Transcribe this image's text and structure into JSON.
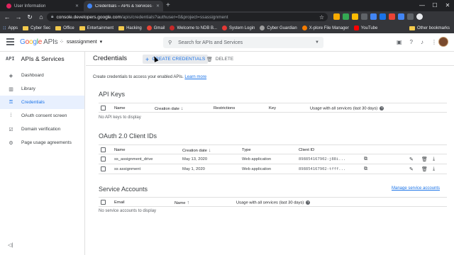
{
  "browser": {
    "tabs": [
      {
        "title": "User Information",
        "favicon_color": "#e0245e",
        "active": false
      },
      {
        "title": "Credentials – APIs & Services – s…",
        "favicon_color": "#4285f4",
        "active": true
      }
    ],
    "url_host": "console.developers.google.com",
    "url_path": "/apis/credentials?authuser=0&project=ssassignment",
    "bookmarks": [
      {
        "label": "Apps",
        "kind": "apps"
      },
      {
        "label": "Cyber Sec",
        "kind": "folder"
      },
      {
        "label": "Office",
        "kind": "folder"
      },
      {
        "label": "Entertainment",
        "kind": "folder"
      },
      {
        "label": "Hacking",
        "kind": "folder"
      },
      {
        "label": "Gmail",
        "kind": "site",
        "color": "#ea4335"
      },
      {
        "label": "Welcome to NDB B...",
        "kind": "site",
        "color": "#c62828"
      },
      {
        "label": "System Login",
        "kind": "site",
        "color": "#e53935"
      },
      {
        "label": "Cyber Guardian",
        "kind": "site",
        "color": "#9e9e9e"
      },
      {
        "label": "X-plore File Manager",
        "kind": "site",
        "color": "#f57c00"
      },
      {
        "label": "YouTube",
        "kind": "site",
        "color": "#ff0000"
      }
    ],
    "other_bookmarks": "Other bookmarks",
    "extension_colors": [
      "#f9ab00",
      "#34a853",
      "#fbbc04",
      "#5f6368",
      "#4285f4",
      "#1a73e8",
      "#ea4335",
      "#4285f4",
      "#5f6368",
      "#e8eaed"
    ]
  },
  "header": {
    "logo_google": "Google",
    "logo_apis": " APIs",
    "project": "ssassignment",
    "search_placeholder": "Search for APIs and Services"
  },
  "sidebar": {
    "api_badge": "API",
    "title": "APIs & Services",
    "items": [
      {
        "label": "Dashboard",
        "icon": "◈"
      },
      {
        "label": "Library",
        "icon": "▥"
      },
      {
        "label": "Credentials",
        "icon": "⚿"
      },
      {
        "label": "OAuth consent screen",
        "icon": "⁞"
      },
      {
        "label": "Domain verification",
        "icon": "☑"
      },
      {
        "label": "Page usage agreements",
        "icon": "⚙"
      }
    ],
    "active_index": 2,
    "collapse_icon": "◁|"
  },
  "main": {
    "title": "Credentials",
    "create_label": "CREATE CREDENTIALS",
    "delete_label": "DELETE",
    "intro": "Create credentials to access your enabled APIs.",
    "learn_more": "Learn more",
    "api_keys": {
      "title": "API Keys",
      "columns": [
        "Name",
        "Creation date",
        "Restrictions",
        "Key",
        "Usage with all services (last 30 days)"
      ],
      "empty": "No API keys to display"
    },
    "oauth": {
      "title": "OAuth 2.0 Client IDs",
      "columns": [
        "Name",
        "Creation date",
        "Type",
        "Client ID"
      ],
      "rows": [
        {
          "name": "ss_assignment_drive",
          "date": "May 13, 2020",
          "type": "Web application",
          "client_id": "898854167902-j88i..."
        },
        {
          "name": "ss assignment",
          "date": "May 1, 2020",
          "type": "Web application",
          "client_id": "898854167902-tfff..."
        }
      ]
    },
    "service_accounts": {
      "title": "Service Accounts",
      "manage_link": "Manage service accounts",
      "columns": [
        "Email",
        "Name",
        "Usage with all services (last 30 days)"
      ],
      "empty": "No service accounts to display"
    }
  }
}
